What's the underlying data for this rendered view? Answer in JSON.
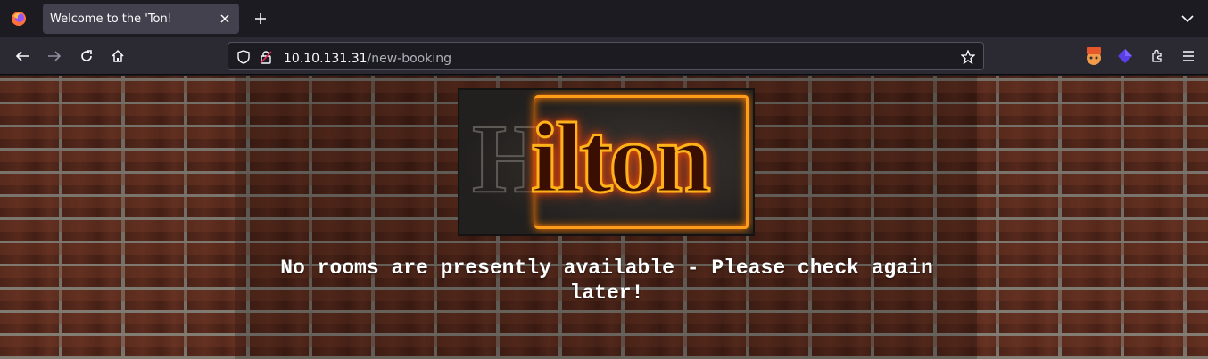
{
  "browser": {
    "tab": {
      "title": "Welcome to the 'Ton!",
      "close_icon": "close-icon"
    },
    "new_tab_symbol": "+",
    "urlbar": {
      "host": "10.10.131.31",
      "path": "/new-booking"
    },
    "extensions": [
      "burp-icon",
      "purple-cube-icon",
      "extensions-icon",
      "menu-icon"
    ]
  },
  "page": {
    "logo_text": "ilton",
    "message": "No rooms are presently available - Please check again later!"
  },
  "colors": {
    "neon": "#ff9d1a",
    "brick": "#5a2a1d",
    "chrome_dark": "#1c1b22",
    "chrome_bar": "#2b2a33"
  }
}
